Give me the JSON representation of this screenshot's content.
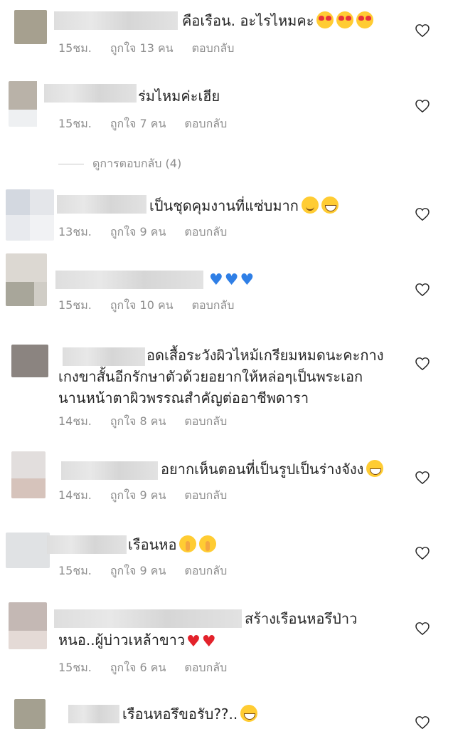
{
  "comments": [
    {
      "text": "คือเรือน.  อะไรไหมคะ",
      "time": "15ชม.",
      "likes": "ถูกใจ 13 คน",
      "reply": "ตอบกลับ"
    },
    {
      "text": "ร่มไหมค่ะเฮีย",
      "time": "15ชม.",
      "likes": "ถูกใจ 7 คน",
      "reply": "ตอบกลับ"
    },
    {
      "text": "เป็นชุดคุมงานที่แซ่บมาก",
      "time": "13ชม.",
      "likes": "ถูกใจ 9 คน",
      "reply": "ตอบกลับ"
    },
    {
      "text": "",
      "time": "15ชม.",
      "likes": "ถูกใจ 10 คน",
      "reply": "ตอบกลับ"
    },
    {
      "text_line1": "อดเสื้อระวังผิวไหม้เกรียมหมดนะคะกาง",
      "text_line2": "เกงขาสั้นอีกรักษาตัวด้วยอยากให้หล่อๆเป็นพระเอก",
      "text_line3": "นานหน้าตาผิวพรรณสำคัญต่ออาชีพดารา",
      "time": "14ชม.",
      "likes": "ถูกใจ 8 คน",
      "reply": "ตอบกลับ"
    },
    {
      "text": "อยากเห็นตอนที่เป็นรูปเป็นร่างจังง",
      "time": "14ชม.",
      "likes": "ถูกใจ 9 คน",
      "reply": "ตอบกลับ"
    },
    {
      "text": "เรือนหอ",
      "time": "15ชม.",
      "likes": "ถูกใจ 9 คน",
      "reply": "ตอบกลับ"
    },
    {
      "text_line1": "สร้างเรือนหอรึป่าว",
      "text_line2": "หนอ..ผู้บ่าวเหล้าขาว",
      "time": "15ชม.",
      "likes": "ถูกใจ 6 คน",
      "reply": "ตอบกลับ"
    },
    {
      "text": "เรือนหอรึขอรับ??..",
      "time": "",
      "likes": "",
      "reply": ""
    }
  ],
  "view_replies": "ดูการตอบกลับ (4)",
  "icons": {
    "like": "heart-outline-icon"
  },
  "colors": {
    "meta": "#8e8e8e",
    "text": "#262626"
  }
}
